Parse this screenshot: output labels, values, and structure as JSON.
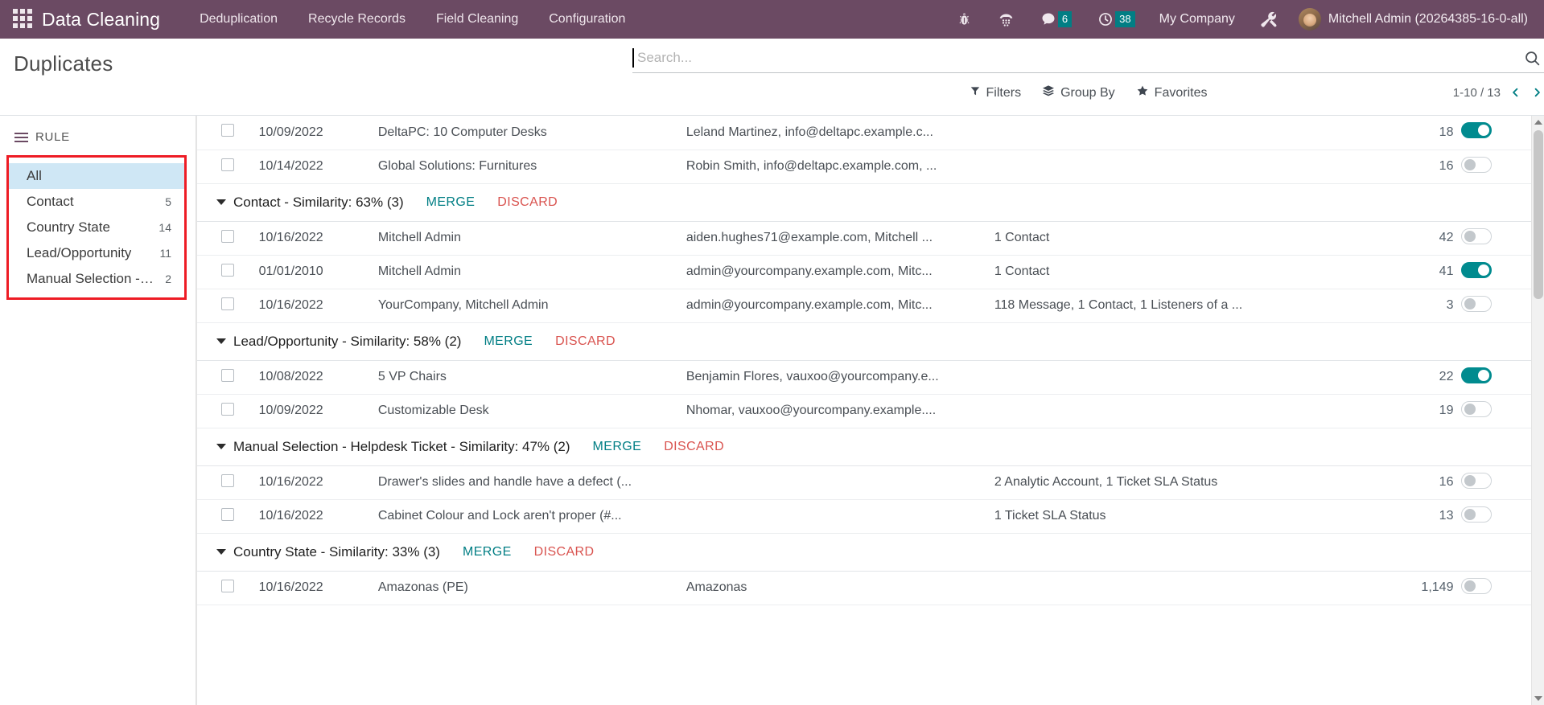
{
  "navbar": {
    "apps_icon": "apps-grid-icon",
    "brand": "Data Cleaning",
    "menu": [
      {
        "label": "Deduplication"
      },
      {
        "label": "Recycle Records"
      },
      {
        "label": "Field Cleaning"
      },
      {
        "label": "Configuration"
      }
    ],
    "systray": [
      {
        "name": "bug-icon",
        "badge": ""
      },
      {
        "name": "dialpad-icon",
        "badge": ""
      },
      {
        "name": "messages-icon",
        "badge": "6"
      },
      {
        "name": "activities-clock-icon",
        "badge": "38"
      }
    ],
    "company": "My Company",
    "tools_icon": "tools-wrench-icon",
    "user": "Mitchell Admin (20264385-16-0-all)",
    "accent": "#6b4a63",
    "badge_color": "#017e84"
  },
  "control_panel": {
    "title": "Duplicates",
    "search": {
      "placeholder": "Search...",
      "value": ""
    },
    "search_icon": "search-icon",
    "buttons": [
      {
        "label": "Filters",
        "icon": "filter-funnel-icon"
      },
      {
        "label": "Group By",
        "icon": "layers-icon"
      },
      {
        "label": "Favorites",
        "icon": "star-icon"
      }
    ],
    "pager": {
      "text": "1-10 / 13",
      "prev_icon": "chevron-left-icon",
      "next_icon": "chevron-right-icon"
    }
  },
  "sidebar": {
    "title": "RULE",
    "menu_icon": "hamburger-icon",
    "highlight_color": "#ee1c25",
    "items": [
      {
        "label": "All",
        "count": "",
        "active": true
      },
      {
        "label": "Contact",
        "count": "5",
        "active": false
      },
      {
        "label": "Country State",
        "count": "14",
        "active": false
      },
      {
        "label": "Lead/Opportunity",
        "count": "11",
        "active": false
      },
      {
        "label": "Manual Selection - H...",
        "count": "2",
        "active": false
      }
    ]
  },
  "list": {
    "merge_label": "MERGE",
    "discard_label": "DISCARD",
    "rows": [
      {
        "kind": "record",
        "date": "10/09/2022",
        "name": "DeltaPC: 10 Computer Desks",
        "email": "Leland Martinez, info@deltapc.example.c...",
        "refs": "",
        "count": "18",
        "toggle": true
      },
      {
        "kind": "record",
        "date": "10/14/2022",
        "name": "Global Solutions: Furnitures",
        "email": "Robin Smith, info@deltapc.example.com, ...",
        "refs": "",
        "count": "16",
        "toggle": false
      },
      {
        "kind": "group",
        "title": "Contact - Similarity: 63% (3)"
      },
      {
        "kind": "record",
        "date": "10/16/2022",
        "name": "Mitchell Admin",
        "email": "aiden.hughes71@example.com, Mitchell ...",
        "refs": "1 Contact",
        "count": "42",
        "toggle": false
      },
      {
        "kind": "record",
        "date": "01/01/2010",
        "name": "Mitchell Admin",
        "email": "admin@yourcompany.example.com, Mitc...",
        "refs": "1 Contact",
        "count": "41",
        "toggle": true
      },
      {
        "kind": "record",
        "date": "10/16/2022",
        "name": "YourCompany, Mitchell Admin",
        "email": "admin@yourcompany.example.com, Mitc...",
        "refs": "118 Message, 1 Contact, 1 Listeners of a ...",
        "count": "3",
        "toggle": false
      },
      {
        "kind": "group",
        "title": "Lead/Opportunity - Similarity: 58% (2)"
      },
      {
        "kind": "record",
        "date": "10/08/2022",
        "name": "5 VP Chairs",
        "email": "Benjamin Flores, vauxoo@yourcompany.e...",
        "refs": "",
        "count": "22",
        "toggle": true
      },
      {
        "kind": "record",
        "date": "10/09/2022",
        "name": "Customizable Desk",
        "email": "Nhomar, vauxoo@yourcompany.example....",
        "refs": "",
        "count": "19",
        "toggle": false
      },
      {
        "kind": "group",
        "title": "Manual Selection - Helpdesk Ticket - Similarity: 47% (2)"
      },
      {
        "kind": "record",
        "date": "10/16/2022",
        "name": "Drawer's slides and handle have a defect (...",
        "email": "",
        "refs": "2 Analytic Account, 1 Ticket SLA Status",
        "count": "16",
        "toggle": false
      },
      {
        "kind": "record",
        "date": "10/16/2022",
        "name": "Cabinet Colour and Lock aren't proper (#...",
        "email": "",
        "refs": "1 Ticket SLA Status",
        "count": "13",
        "toggle": false
      },
      {
        "kind": "group",
        "title": "Country State - Similarity: 33% (3)"
      },
      {
        "kind": "record",
        "date": "10/16/2022",
        "name": "Amazonas (PE)",
        "email": "Amazonas",
        "refs": "",
        "count": "1,149",
        "toggle": false
      }
    ]
  }
}
